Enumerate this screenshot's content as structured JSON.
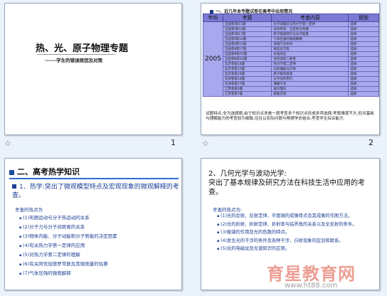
{
  "slides": [
    {
      "number": "1",
      "title": "热、光、原子物理专题",
      "subtitle": "------学生的错误原因及对策"
    },
    {
      "number": "2",
      "heading": "一、近几年本专题试卷在高考中出现情况",
      "table": {
        "headers": [
          "年份",
          "考题",
          "考查内容",
          "题型"
        ],
        "year": "2005",
        "rows": [
          [
            "全国卷Ⅰ第15题",
            "分子动理论与热力学第一定律",
            "选择"
          ],
          [
            "全国卷Ⅰ第16题",
            "光的折射、全反射与色散",
            "选择"
          ],
          [
            "全国卷Ⅰ第17题",
            "原子能级跃迁与光子能量",
            "选择"
          ],
          [
            "全国卷Ⅱ第14题",
            "气体压强的微观解释",
            "选择"
          ],
          [
            "全国卷Ⅱ第15题",
            "双缝干涉条纹",
            "选择"
          ],
          [
            "全国卷Ⅱ第17题",
            "核反应方程",
            "选择"
          ],
          [
            "全国卷Ⅲ第15题",
            "光电效应",
            "选择"
          ],
          [
            "全国卷Ⅲ第16题",
            "光的波粒二象性",
            "选择"
          ],
          [
            "北京卷第14题",
            "热力学第二定律",
            "选择"
          ],
          [
            "北京卷第15题",
            "光的偏振与衍射",
            "选择"
          ],
          [
            "北京卷第16题",
            "原子核的衰变",
            "选择"
          ],
          [
            "天津卷第14题",
            "分子间作用力",
            "选择"
          ],
          [
            "天津卷第17题",
            "薄膜干涉",
            "选择"
          ],
          [
            "江苏卷第2题",
            "玻尔理论",
            "选择"
          ],
          [
            "江苏卷第7题",
            "质能方程",
            "选择"
          ]
        ]
      },
      "footer": "试题特点:全为选择题;由于知识点多故一题考查多个知识点形成多项选择;考题难度不大,但对基础与理解能力的考查较为细致,往往以实际问题与物理学史结合,考查学生综合能力."
    },
    {
      "number": "",
      "title": "二、高考热学知识",
      "lead": "1、热学:突出了微观模型特点及宏观现象的微观解释的考查。",
      "sub": "考查的热点为",
      "items": [
        "(1)布朗运动与分子热运动的关系",
        "(2)分子力与分子间距离的关系",
        "(3)物体内能、分子动能和分子势能的决定因素",
        "(4)有关热力学第一定律的应用",
        "(5)对热力学第二定律的理解",
        "(6)有关阿伏加德罗常数及其微观量的估算",
        "(7)气体压强的微观解释"
      ]
    },
    {
      "number": "",
      "title": "2、几何光学与波动光学:",
      "lead": "突出了基本规律及研究方法在科技生活中应用的考查。",
      "sub": "考查的热点为:",
      "items": [
        "(1)光的反射、反射定律、平面镜的成像特点及其成像的作图方法。",
        "(2)光的折射、折射定律、折射率与临界角的关系以及全反射的条件。",
        "(3)棱镜的作用及光的色散的特点。",
        "(4)发生光的干涉的条件及各种干涉、衍射现象的区别和联系。",
        "(5)光的电磁说及光谱知识的应用。"
      ]
    }
  ],
  "watermark": {
    "text": "育星教育网",
    "url": "www.ht88.com"
  },
  "star_icon": "☆"
}
